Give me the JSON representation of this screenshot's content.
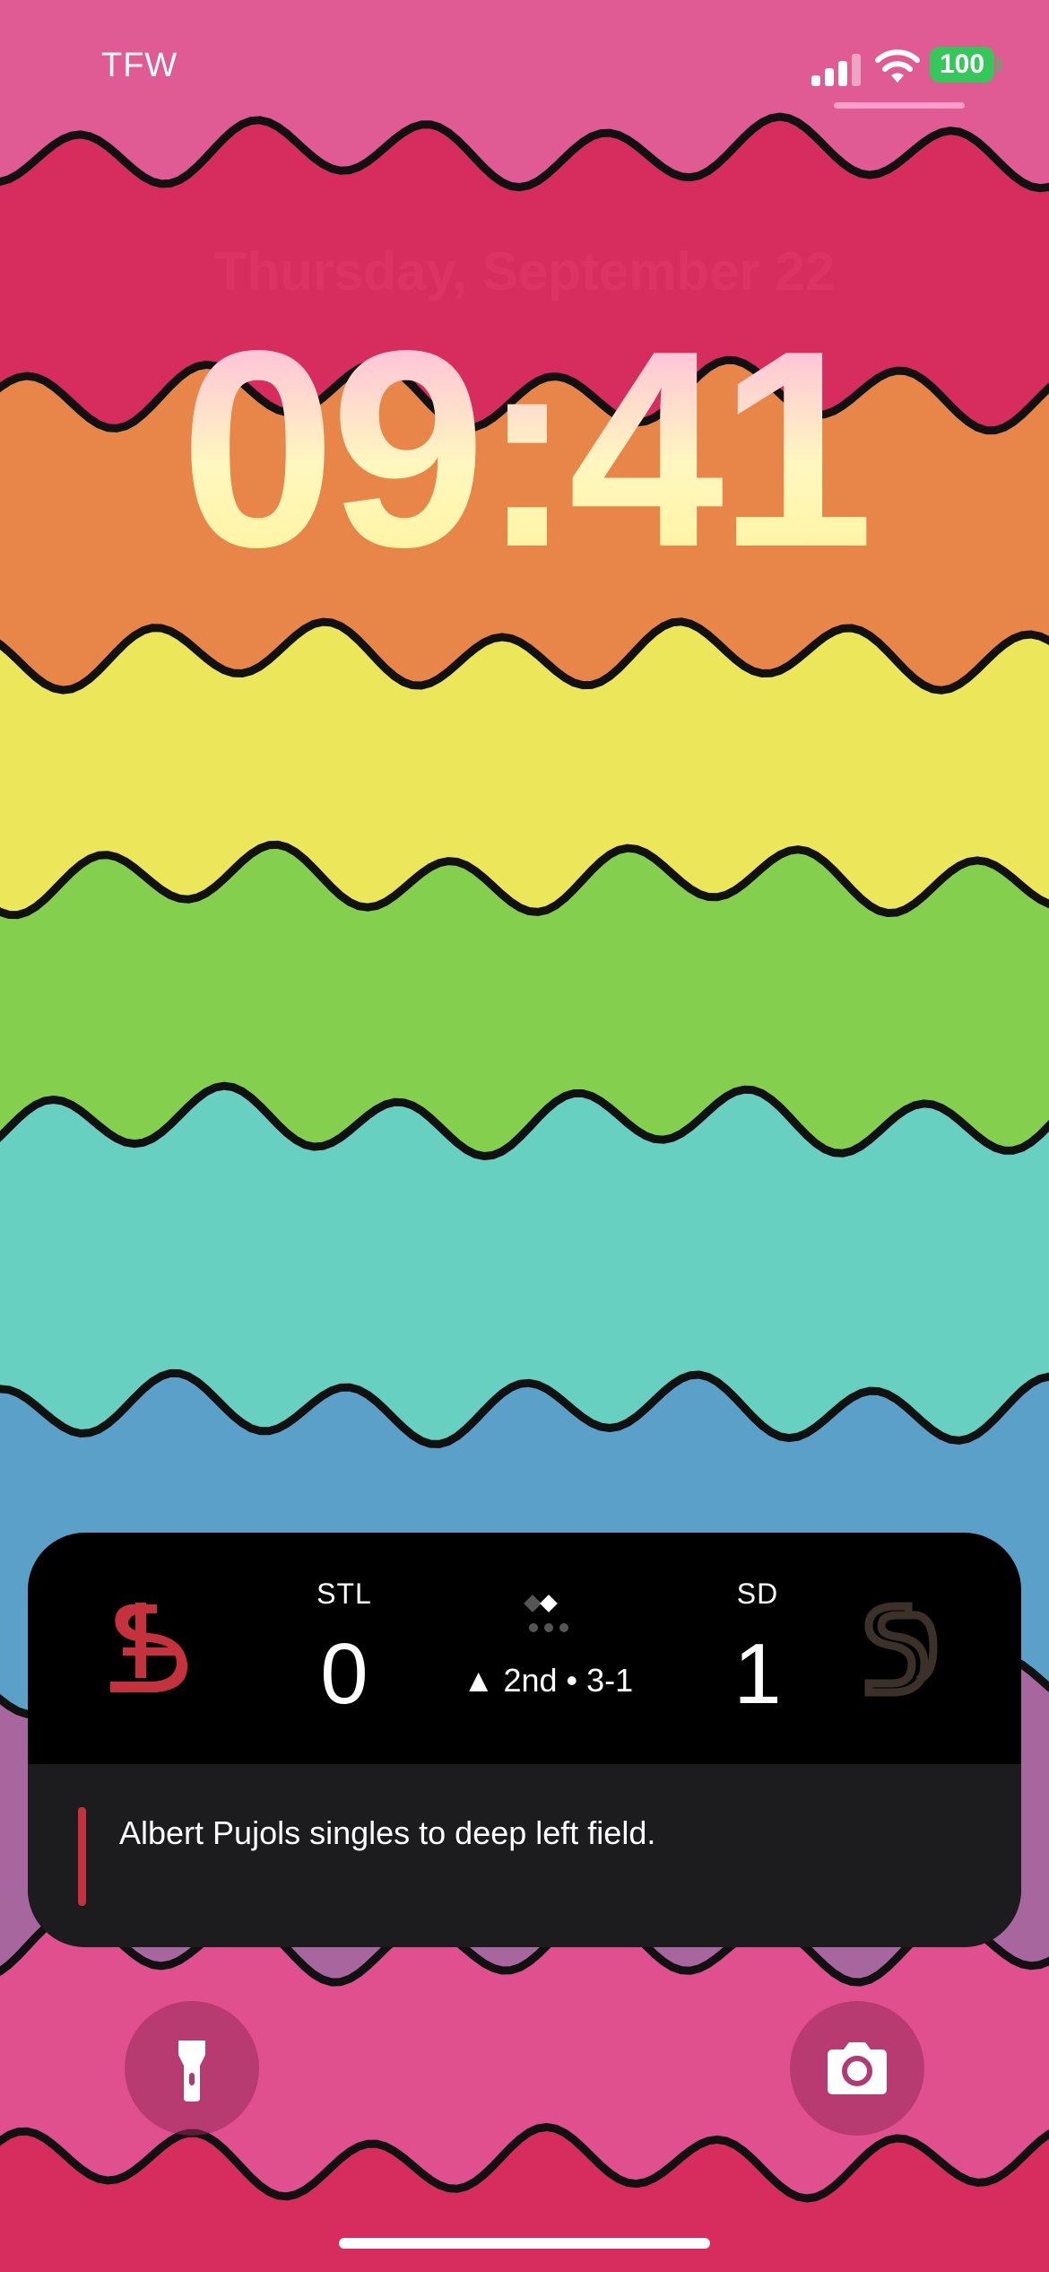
{
  "status_bar": {
    "carrier": "TFW",
    "battery": "100",
    "colors": {
      "battery": "#35c759",
      "text": "#ffffff"
    }
  },
  "lock_screen": {
    "date": "Thursday, September 22",
    "time": "09:41"
  },
  "live_activity": {
    "away": {
      "abbr": "STL",
      "score": "0",
      "logo_icon": "cardinals-logo-icon",
      "color": "#c4323d"
    },
    "home": {
      "abbr": "SD",
      "score": "1",
      "logo_icon": "padres-logo-icon",
      "color": "#3b302a"
    },
    "inning": "▲ 2nd • 3-1",
    "bases_icon": "bases-diamond-icon",
    "play_by_play": "Albert Pujols singles to deep left field."
  },
  "bottom_controls": {
    "left_icon": "flashlight-icon",
    "right_icon": "camera-icon"
  }
}
